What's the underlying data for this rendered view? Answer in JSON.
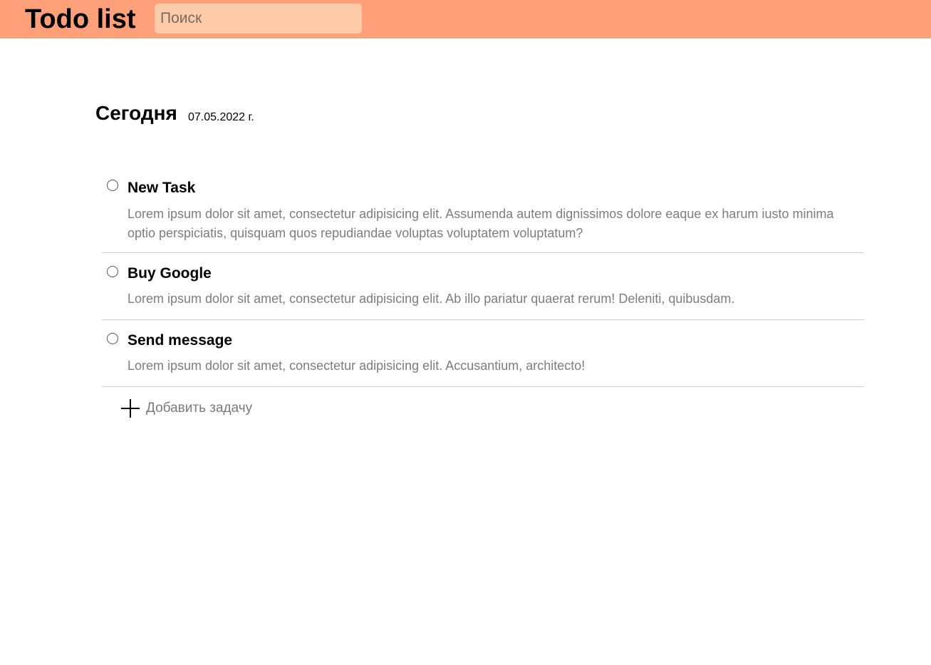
{
  "header": {
    "title": "Todo list",
    "search_placeholder": "Поиск"
  },
  "section": {
    "title": "Сегодня",
    "date": "07.05.2022 г."
  },
  "tasks": [
    {
      "title": "New Task",
      "description": "Lorem ipsum dolor sit amet, consectetur adipisicing elit. Assumenda autem dignissimos dolore eaque ex harum iusto minima optio perspiciatis, quisquam quos repudiandae voluptas voluptatem voluptatum?"
    },
    {
      "title": "Buy Google",
      "description": "Lorem ipsum dolor sit amet, consectetur adipisicing elit. Ab illo pariatur quaerat rerum! Deleniti, quibusdam."
    },
    {
      "title": "Send message",
      "description": "Lorem ipsum dolor sit amet, consectetur adipisicing elit. Accusantium, architecto!"
    }
  ],
  "add_task": {
    "label": "Добавить задачу",
    "icon": "plus-icon"
  },
  "colors": {
    "header_bg": "#ffa07a",
    "search_bg": "#ffcba8",
    "description_text": "#7d7d7d",
    "divider": "#cfcfcf"
  }
}
